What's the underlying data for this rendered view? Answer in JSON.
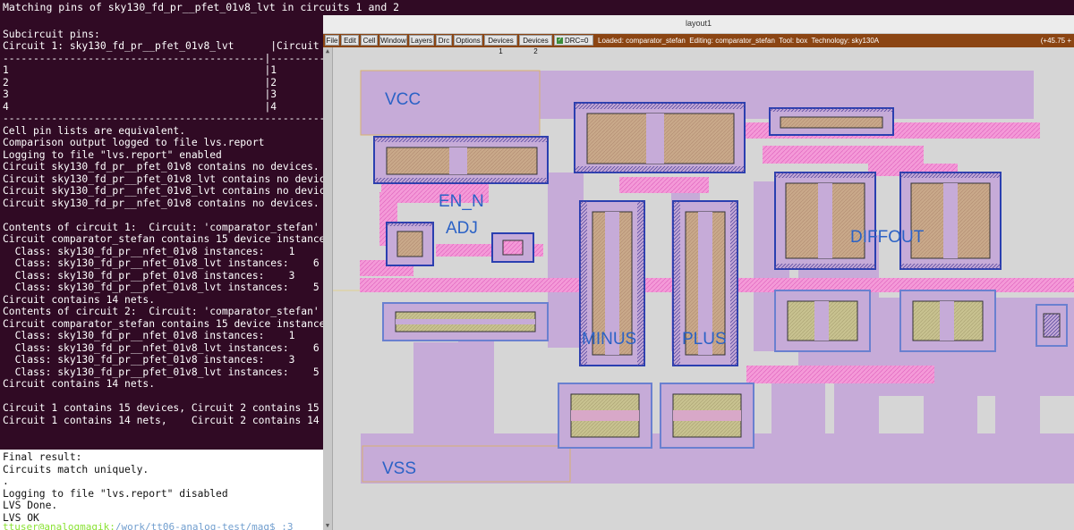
{
  "terminal": {
    "title": "Matching pins of sky130_fd_pr__pfet_01v8_lvt in circuits 1 and 2",
    "lines": [
      "",
      "Subcircuit pins:",
      "Circuit 1: sky130_fd_pr__pfet_01v8_lvt      |Circuit 2",
      "-------------------------------------------|---------",
      "1                                          |1",
      "2                                          |2",
      "3                                          |3",
      "4                                          |4",
      "--------------------------------------------------------",
      "Cell pin lists are equivalent.",
      "Comparison output logged to file lvs.report",
      "Logging to file \"lvs.report\" enabled",
      "Circuit sky130_fd_pr__pfet_01v8 contains no devices.",
      "Circuit sky130_fd_pr__pfet_01v8_lvt contains no devic",
      "Circuit sky130_fd_pr__nfet_01v8_lvt contains no devic",
      "Circuit sky130_fd_pr__nfet_01v8 contains no devices.",
      "",
      "Contents of circuit 1:  Circuit: 'comparator_stefan'",
      "Circuit comparator_stefan contains 15 device instance",
      "  Class: sky130_fd_pr__nfet_01v8 instances:    1",
      "  Class: sky130_fd_pr__nfet_01v8_lvt instances:    6",
      "  Class: sky130_fd_pr__pfet_01v8 instances:    3",
      "  Class: sky130_fd_pr__pfet_01v8_lvt instances:    5",
      "Circuit contains 14 nets.",
      "Contents of circuit 2:  Circuit: 'comparator_stefan'",
      "Circuit comparator_stefan contains 15 device instance",
      "  Class: sky130_fd_pr__nfet_01v8 instances:    1",
      "  Class: sky130_fd_pr__nfet_01v8_lvt instances:    6",
      "  Class: sky130_fd_pr__pfet_01v8 instances:    3",
      "  Class: sky130_fd_pr__pfet_01v8_lvt instances:    5",
      "Circuit contains 14 nets.",
      "",
      "Circuit 1 contains 15 devices, Circuit 2 contains 15",
      "Circuit 1 contains 14 nets,    Circuit 2 contains 14",
      "",
      ""
    ],
    "final_lines": [
      "Final result:",
      "Circuits match uniquely.",
      ".",
      "Logging to file \"lvs.report\" disabled",
      "LVS Done.",
      "LVS OK"
    ],
    "prompt_user": "ttuser@analogmagik:",
    "prompt_path": "/work/tt06-analog-test/mag$ :3"
  },
  "magic": {
    "window_title": "layout1",
    "menu": [
      "File",
      "Edit",
      "Cell",
      "Window",
      "Layers",
      "Drc",
      "Options",
      "Devices 1",
      "Devices 2"
    ],
    "drc_label": "DRC=0",
    "status": "Loaded: comparator_stefan  Editing: comparator_stefan  Tool: box  Technology: sky130A",
    "coords": "(+45.75 +",
    "labels": {
      "vcc": "VCC",
      "en_n": "EN_N",
      "adj": "ADJ",
      "diffout": "DIFFOUT",
      "minus": "MINUS",
      "plus": "PLUS",
      "vss": "VSS"
    },
    "colors": {
      "background": "#d6d6d6",
      "metal": "#c6abd8",
      "poly_pink": "#f49ad8",
      "diffusion": "#c9a98a",
      "label_blue": "#2b62c6",
      "menubar": "#8b4513"
    }
  }
}
